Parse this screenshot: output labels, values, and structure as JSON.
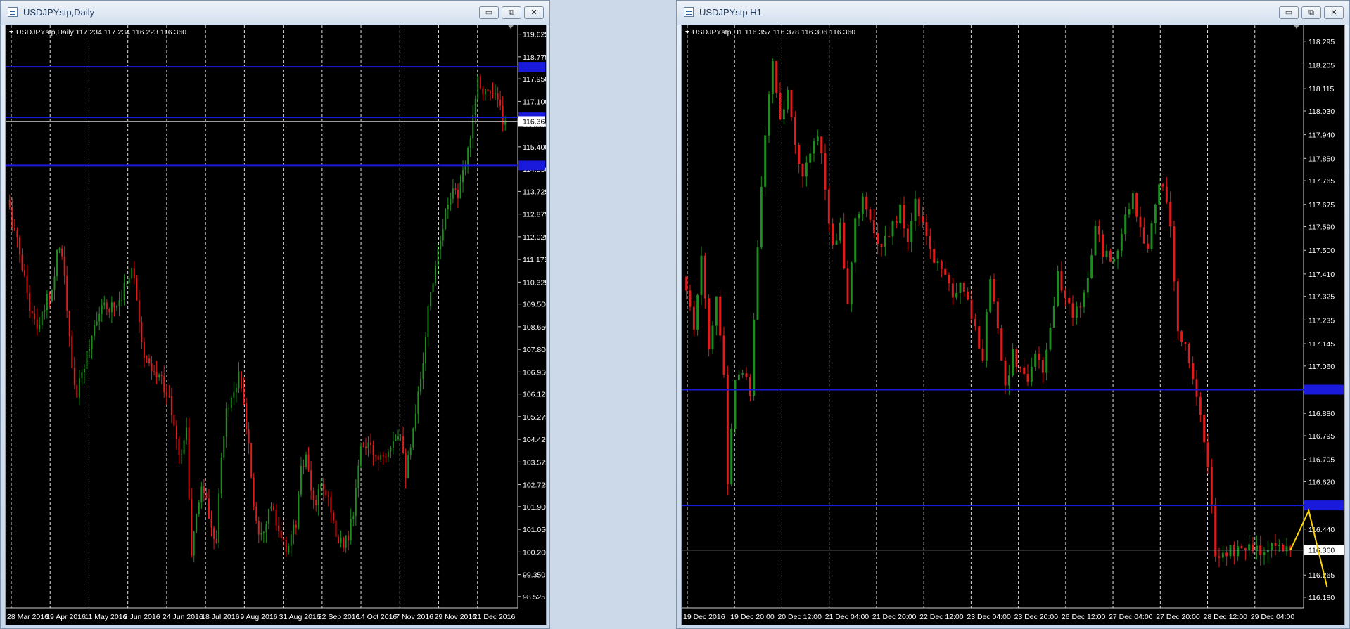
{
  "left_window": {
    "title": "USDJPYstp,Daily",
    "controls": {
      "minimize": "▭",
      "maximize": "⧉",
      "close": "✕"
    }
  },
  "right_window": {
    "title": "USDJPYstp,H1",
    "controls": {
      "minimize": "▭",
      "maximize": "⧉",
      "close": "✕"
    }
  },
  "colors": {
    "background": "#000000",
    "grid": "#ffffff",
    "bull_candle": "#1e8c1e",
    "bear_candle": "#e01b1b",
    "hline": "#1a1adc",
    "price_line": "#a0a0a0",
    "projection": "#ffd700",
    "axis_text": "#ffffff"
  },
  "chart_data": [
    {
      "type": "candlestick",
      "symbol": "USDJPYstp,Daily",
      "header_info": "USDJPYstp,Daily  117.234 117.234 116.223 116.360",
      "ylim": [
        98.1,
        119.8
      ],
      "y_ticks": [
        "119.625",
        "118.775",
        "117.950",
        "117.100",
        "116.250",
        "115.400",
        "114.550",
        "113.725",
        "112.875",
        "112.025",
        "111.175",
        "110.325",
        "109.500",
        "108.650",
        "107.800",
        "106.950",
        "106.125",
        "105.275",
        "104.425",
        "103.575",
        "102.725",
        "101.900",
        "101.050",
        "100.200",
        "99.350",
        "98.525"
      ],
      "x_labels": [
        "28 Mar 2016",
        "19 Apr 2016",
        "11 May 2016",
        "2 Jun 2016",
        "24 Jun 2016",
        "18 Jul 2016",
        "9 Aug 2016",
        "31 Aug 2016",
        "22 Sep 2016",
        "14 Oct 2016",
        "7 Nov 2016",
        "29 Nov 2016",
        "21 Dec 2016"
      ],
      "horizontal_lines": [
        118.4,
        116.5,
        114.7
      ],
      "current_price": 116.36,
      "candle_count": 200,
      "anchors": [
        [
          0,
          113.4
        ],
        [
          5,
          111.4
        ],
        [
          10,
          109.0
        ],
        [
          13,
          108.6
        ],
        [
          16,
          109.7
        ],
        [
          18,
          110.0
        ],
        [
          20,
          111.6
        ],
        [
          22,
          111.5
        ],
        [
          26,
          107.0
        ],
        [
          28,
          106.1
        ],
        [
          32,
          107.6
        ],
        [
          36,
          109.1
        ],
        [
          40,
          109.4
        ],
        [
          44,
          109.5
        ],
        [
          48,
          110.3
        ],
        [
          50,
          111.0
        ],
        [
          52,
          109.8
        ],
        [
          55,
          107.5
        ],
        [
          58,
          106.9
        ],
        [
          62,
          106.7
        ],
        [
          65,
          105.9
        ],
        [
          68,
          104.3
        ],
        [
          70,
          103.8
        ],
        [
          72,
          105.0
        ],
        [
          73,
          102.0
        ],
        [
          74,
          100.2
        ],
        [
          76,
          101.5
        ],
        [
          78,
          102.7
        ],
        [
          80,
          102.2
        ],
        [
          82,
          101.0
        ],
        [
          84,
          100.8
        ],
        [
          86,
          103.7
        ],
        [
          88,
          105.5
        ],
        [
          90,
          106.0
        ],
        [
          93,
          106.8
        ],
        [
          95,
          105.7
        ],
        [
          97,
          104.2
        ],
        [
          99,
          102.0
        ],
        [
          101,
          101.0
        ],
        [
          103,
          101.2
        ],
        [
          106,
          102.0
        ],
        [
          109,
          100.8
        ],
        [
          112,
          100.3
        ],
        [
          116,
          101.3
        ],
        [
          118,
          103.2
        ],
        [
          120,
          103.8
        ],
        [
          122,
          102.3
        ],
        [
          124,
          102.0
        ],
        [
          126,
          102.6
        ],
        [
          128,
          102.4
        ],
        [
          130,
          101.9
        ],
        [
          132,
          100.7
        ],
        [
          134,
          100.5
        ],
        [
          137,
          100.8
        ],
        [
          139,
          101.6
        ],
        [
          141,
          103.5
        ],
        [
          143,
          104.3
        ],
        [
          146,
          104.0
        ],
        [
          149,
          103.8
        ],
        [
          152,
          104.0
        ],
        [
          155,
          104.5
        ],
        [
          158,
          104.8
        ],
        [
          160,
          103.2
        ],
        [
          162,
          104.0
        ],
        [
          164,
          105.3
        ],
        [
          167,
          107.5
        ],
        [
          169,
          109.3
        ],
        [
          171,
          110.5
        ],
        [
          173,
          111.7
        ],
        [
          175,
          112.5
        ],
        [
          177,
          113.3
        ],
        [
          179,
          114.0
        ],
        [
          181,
          113.5
        ],
        [
          183,
          114.3
        ],
        [
          185,
          115.2
        ],
        [
          187,
          116.7
        ],
        [
          189,
          118.0
        ],
        [
          191,
          117.6
        ],
        [
          193,
          117.4
        ],
        [
          195,
          117.3
        ],
        [
          197,
          117.1
        ],
        [
          199,
          116.36
        ]
      ]
    },
    {
      "type": "candlestick",
      "symbol": "USDJPYstp,H1",
      "header_info": "USDJPYstp,H1  116.357 116.378 116.306 116.360",
      "ylim": [
        116.14,
        118.34
      ],
      "y_ticks": [
        "118.295",
        "118.205",
        "118.115",
        "118.030",
        "117.940",
        "117.850",
        "117.765",
        "117.675",
        "117.590",
        "117.500",
        "117.410",
        "117.325",
        "117.235",
        "117.145",
        "117.060",
        "116.970",
        "116.880",
        "116.795",
        "116.705",
        "116.620",
        "116.530",
        "116.440",
        "116.360",
        "116.265",
        "116.180"
      ],
      "x_labels": [
        "19 Dec 2016",
        "19 Dec 20:00",
        "20 Dec 12:00",
        "21 Dec 04:00",
        "21 Dec 20:00",
        "22 Dec 12:00",
        "23 Dec 04:00",
        "23 Dec 20:00",
        "26 Dec 12:00",
        "27 Dec 04:00",
        "27 Dec 20:00",
        "28 Dec 12:00",
        "29 Dec 04:00"
      ],
      "horizontal_lines": [
        116.97,
        116.53
      ],
      "current_price": 116.36,
      "candle_count": 162,
      "anchors": [
        [
          0,
          117.4
        ],
        [
          3,
          117.2
        ],
        [
          5,
          117.5
        ],
        [
          7,
          117.1
        ],
        [
          9,
          117.3
        ],
        [
          11,
          117.05
        ],
        [
          12,
          116.62
        ],
        [
          14,
          117.0
        ],
        [
          16,
          117.05
        ],
        [
          18,
          116.97
        ],
        [
          20,
          117.5
        ],
        [
          22,
          117.95
        ],
        [
          24,
          118.2
        ],
        [
          26,
          118.0
        ],
        [
          28,
          118.1
        ],
        [
          30,
          117.9
        ],
        [
          32,
          117.8
        ],
        [
          34,
          117.85
        ],
        [
          36,
          117.95
        ],
        [
          38,
          117.75
        ],
        [
          40,
          117.5
        ],
        [
          42,
          117.6
        ],
        [
          44,
          117.3
        ],
        [
          46,
          117.6
        ],
        [
          48,
          117.7
        ],
        [
          50,
          117.6
        ],
        [
          52,
          117.5
        ],
        [
          54,
          117.55
        ],
        [
          56,
          117.6
        ],
        [
          58,
          117.65
        ],
        [
          60,
          117.55
        ],
        [
          62,
          117.7
        ],
        [
          64,
          117.6
        ],
        [
          66,
          117.5
        ],
        [
          68,
          117.45
        ],
        [
          70,
          117.4
        ],
        [
          72,
          117.3
        ],
        [
          74,
          117.4
        ],
        [
          76,
          117.3
        ],
        [
          78,
          117.2
        ],
        [
          80,
          117.1
        ],
        [
          82,
          117.4
        ],
        [
          84,
          117.2
        ],
        [
          86,
          117.0
        ],
        [
          88,
          117.1
        ],
        [
          90,
          117.05
        ],
        [
          92,
          117.0
        ],
        [
          94,
          117.1
        ],
        [
          96,
          117.05
        ],
        [
          98,
          117.2
        ],
        [
          100,
          117.4
        ],
        [
          102,
          117.3
        ],
        [
          104,
          117.25
        ],
        [
          106,
          117.3
        ],
        [
          108,
          117.4
        ],
        [
          110,
          117.6
        ],
        [
          112,
          117.5
        ],
        [
          114,
          117.45
        ],
        [
          116,
          117.5
        ],
        [
          118,
          117.65
        ],
        [
          120,
          117.7
        ],
        [
          122,
          117.6
        ],
        [
          124,
          117.5
        ],
        [
          126,
          117.7
        ],
        [
          128,
          117.75
        ],
        [
          130,
          117.6
        ],
        [
          132,
          117.2
        ],
        [
          134,
          117.15
        ],
        [
          136,
          117.0
        ],
        [
          138,
          116.85
        ],
        [
          140,
          116.7
        ],
        [
          142,
          116.35
        ],
        [
          144,
          116.36
        ]
      ],
      "projection": [
        [
          116.36,
          116.51,
          116.22
        ]
      ]
    }
  ]
}
